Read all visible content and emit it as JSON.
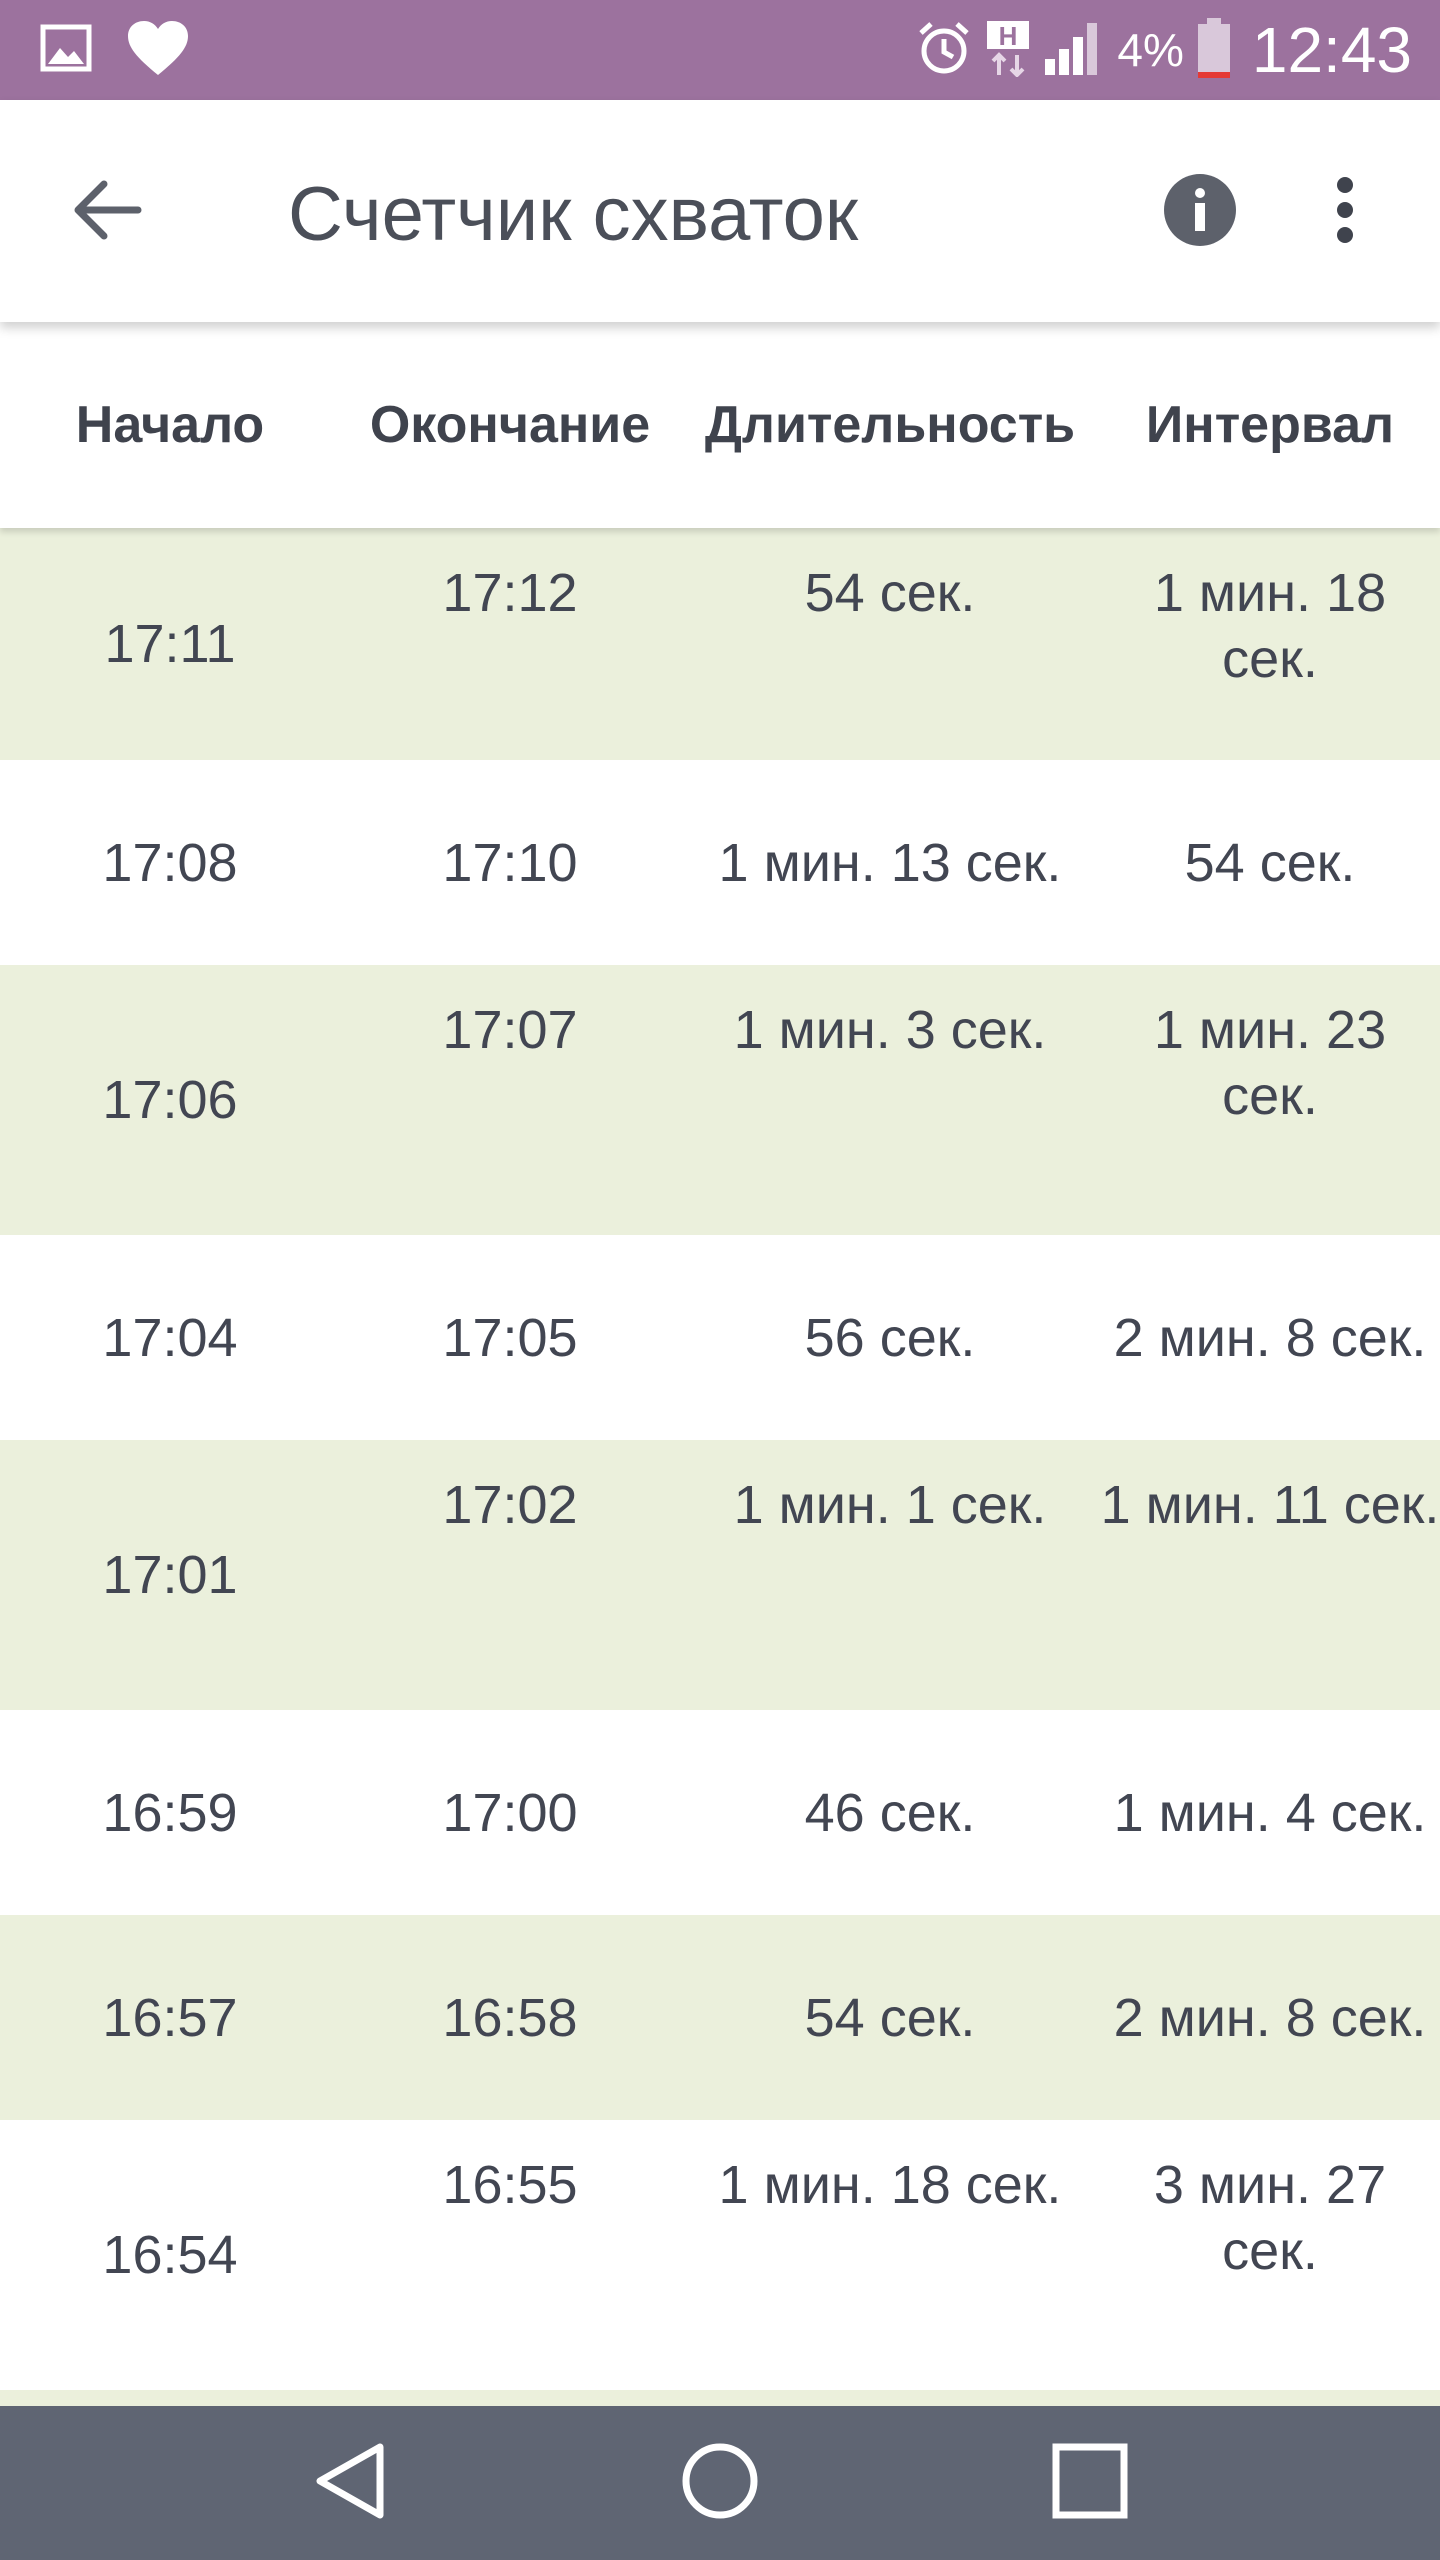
{
  "status_bar": {
    "battery_percent": "4%",
    "time": "12:43",
    "icons": [
      "gallery-icon",
      "heart-icon",
      "alarm-icon",
      "h-network-icon",
      "signal-icon",
      "battery-icon"
    ]
  },
  "app_bar": {
    "title": "Счетчик схваток",
    "icons": [
      "back-arrow-icon",
      "info-icon",
      "more-vert-icon"
    ]
  },
  "table": {
    "headers": [
      "Начало",
      "Окончание",
      "Длительность",
      "Интервал"
    ],
    "rows": [
      {
        "start": "17:11",
        "end": "17:12",
        "duration": "54 сек.",
        "interval": "1 мин. 18 сек."
      },
      {
        "start": "17:08",
        "end": "17:10",
        "duration": "1 мин. 13 сек.",
        "interval": "54 сек."
      },
      {
        "start": "17:06",
        "end": "17:07",
        "duration": "1 мин. 3 сек.",
        "interval": "1 мин. 23 сек."
      },
      {
        "start": "17:04",
        "end": "17:05",
        "duration": "56 сек.",
        "interval": "2 мин. 8 сек."
      },
      {
        "start": "17:01",
        "end": "17:02",
        "duration": "1 мин. 1 сек.",
        "interval": "1 мин. 11 сек."
      },
      {
        "start": "16:59",
        "end": "17:00",
        "duration": "46 сек.",
        "interval": "1 мин. 4 сек."
      },
      {
        "start": "16:57",
        "end": "16:58",
        "duration": "54 сек.",
        "interval": "2 мин. 8 сек."
      },
      {
        "start": "16:54",
        "end": "16:55",
        "duration": "1 мин. 18 сек.",
        "interval": "3 мин. 27 сек."
      }
    ]
  },
  "nav_bar": {
    "icons": [
      "back-triangle-icon",
      "home-circle-icon",
      "recents-square-icon"
    ]
  },
  "colors": {
    "status_bar": "#9c729e",
    "row_shaded": "#ebf0dc",
    "nav_bar": "#5f6573",
    "text": "#424652"
  }
}
